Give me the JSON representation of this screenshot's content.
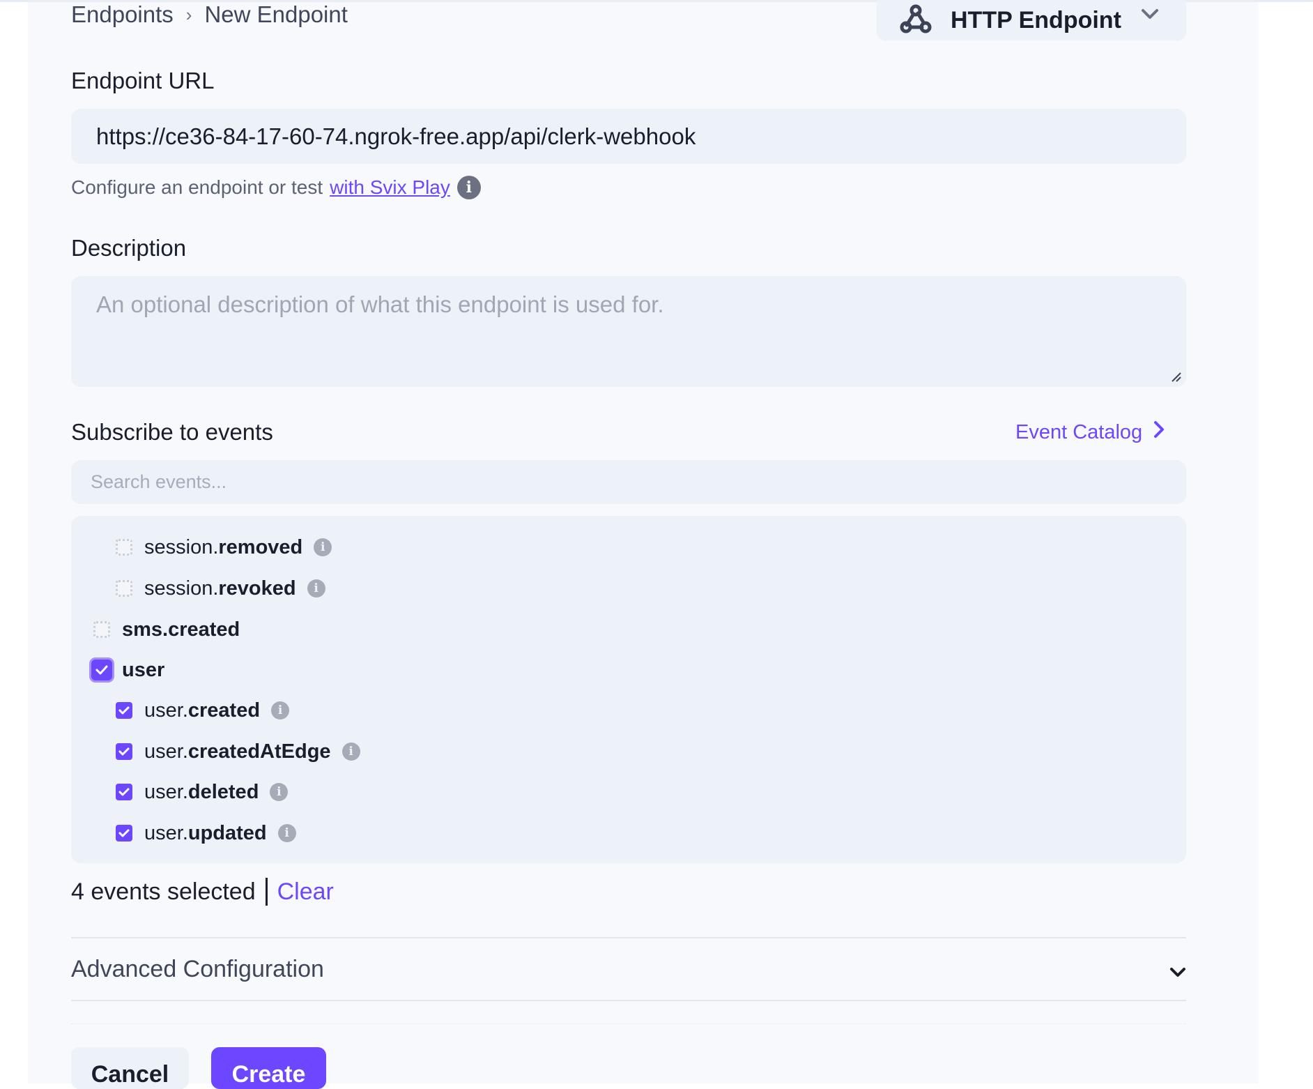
{
  "breadcrumb": {
    "items": [
      "Endpoints",
      "New Endpoint"
    ],
    "separator": "›"
  },
  "endpoint_type": {
    "selected": "HTTP Endpoint",
    "icon": "webhook-icon"
  },
  "url_field": {
    "label": "Endpoint URL",
    "value": "https://ce36-84-17-60-74.ngrok-free.app/api/clerk-webhook"
  },
  "helper": {
    "text": "Configure an endpoint or test",
    "link": "with Svix Play"
  },
  "description_field": {
    "label": "Description",
    "placeholder": "An optional description of what this endpoint is used for.",
    "value": ""
  },
  "events": {
    "title": "Subscribe to events",
    "catalog_link": "Event Catalog",
    "search_placeholder": "Search events...",
    "items": [
      {
        "prefix": "session.",
        "suffix": "removed",
        "checked": false,
        "level": 1,
        "info": true
      },
      {
        "prefix": "session.",
        "suffix": "revoked",
        "checked": false,
        "level": 1,
        "info": true
      },
      {
        "prefix": "",
        "suffix": "sms.created",
        "checked": false,
        "level": 0,
        "info": false
      },
      {
        "prefix": "",
        "suffix": "user",
        "checked": true,
        "level": 0,
        "info": false
      },
      {
        "prefix": "user.",
        "suffix": "created",
        "checked": true,
        "level": 1,
        "info": true
      },
      {
        "prefix": "user.",
        "suffix": "createdAtEdge",
        "checked": true,
        "level": 1,
        "info": true
      },
      {
        "prefix": "user.",
        "suffix": "deleted",
        "checked": true,
        "level": 1,
        "info": true
      },
      {
        "prefix": "user.",
        "suffix": "updated",
        "checked": true,
        "level": 1,
        "info": true
      }
    ],
    "selected_count_text": "4 events selected",
    "clear_label": "Clear"
  },
  "advanced": {
    "label": "Advanced Configuration"
  },
  "actions": {
    "cancel_label": "Cancel",
    "create_label": "Create"
  },
  "colors": {
    "accent": "#6d47ff",
    "field_bg": "#edf1f8",
    "page_bg": "#f7f9fc"
  }
}
